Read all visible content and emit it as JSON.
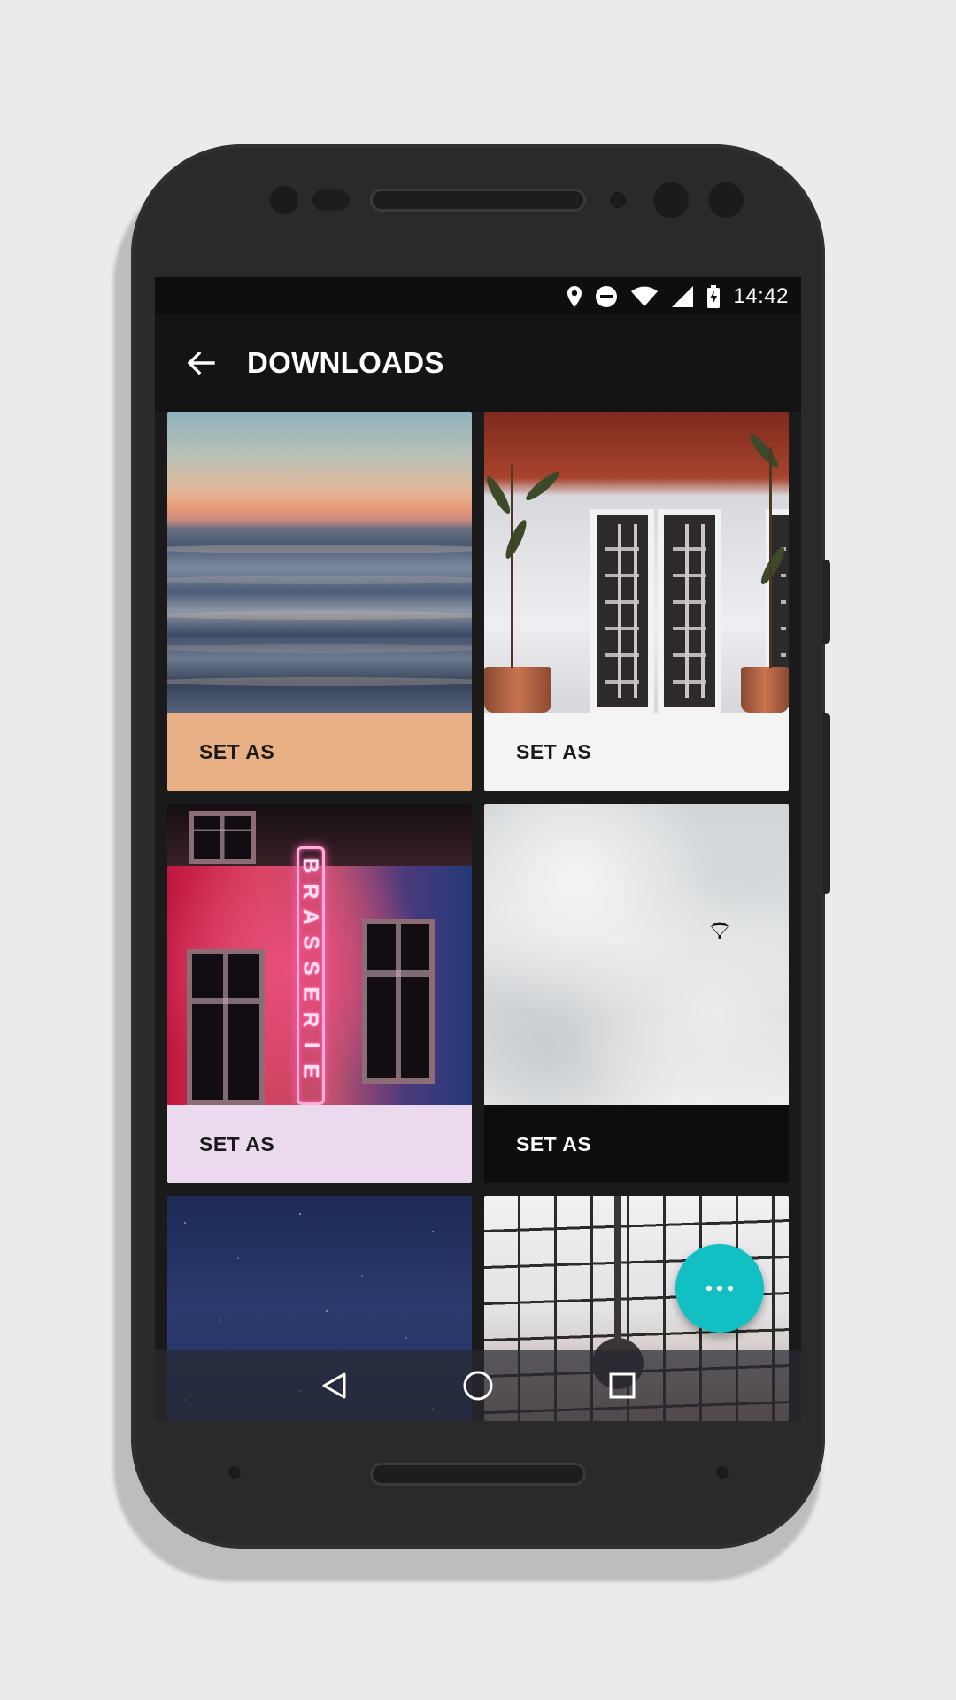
{
  "status_bar": {
    "time": "14:42",
    "icons": [
      "location-icon",
      "do-not-disturb-icon",
      "wifi-icon",
      "cell-signal-icon",
      "battery-charging-icon"
    ]
  },
  "app_bar": {
    "title": "DOWNLOADS",
    "back_icon": "arrow-left-icon"
  },
  "wallpapers": [
    {
      "action_label": "SET AS",
      "action_bg": "#e9af85",
      "action_color": "#1a1a1a"
    },
    {
      "action_label": "SET AS",
      "action_bg": "#f4f4f5",
      "action_color": "#1a1a1a"
    },
    {
      "action_label": "SET AS",
      "action_bg": "#ebd9ee",
      "action_color": "#1a1a1a"
    },
    {
      "action_label": "SET AS",
      "action_bg": "#0c0d0f",
      "action_color": "#ffffff"
    }
  ],
  "neon_text": "BRASSERIE",
  "fab": {
    "icon": "more-horizontal-icon",
    "color": "#12c0c3"
  },
  "nav_bar": {
    "icons": [
      "back-triangle-icon",
      "home-circle-icon",
      "recents-square-icon"
    ]
  },
  "colors": {
    "screen_bg": "#1a1a1a",
    "app_bar_bg": "#141414",
    "accent": "#12c0c3"
  }
}
